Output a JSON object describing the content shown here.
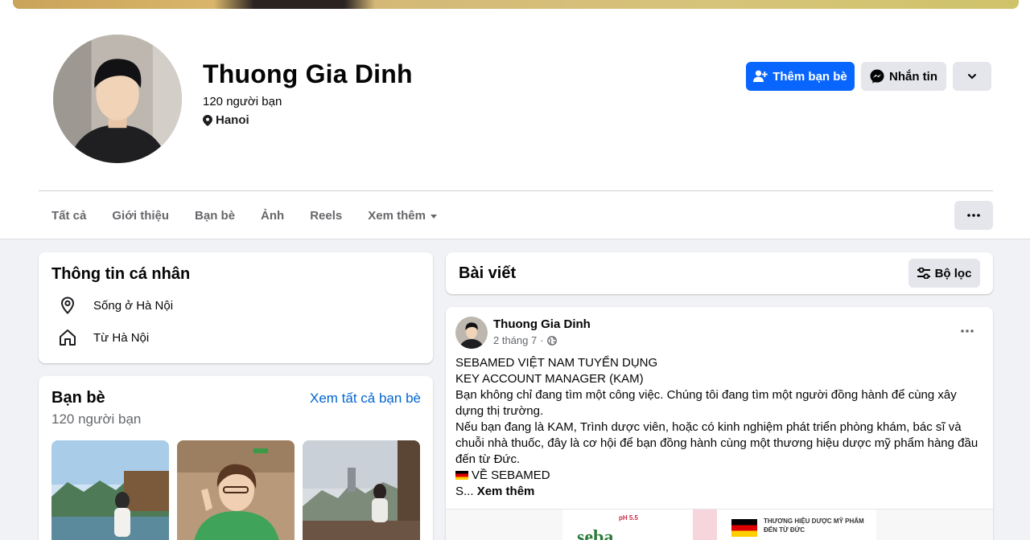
{
  "profile": {
    "name": "Thuong Gia Dinh",
    "friend_count": "120 người bạn",
    "location": "Hanoi"
  },
  "actions": {
    "add_friend": "Thêm bạn bè",
    "message": "Nhắn tin"
  },
  "tabs": [
    {
      "label": "Tất cả"
    },
    {
      "label": "Giới thiệu"
    },
    {
      "label": "Bạn bè"
    },
    {
      "label": "Ảnh"
    },
    {
      "label": "Reels"
    },
    {
      "label": "Xem thêm"
    }
  ],
  "intro": {
    "title": "Thông tin cá nhân",
    "lives_in": "Sống ở Hà Nội",
    "from": "Từ Hà Nội"
  },
  "friends": {
    "title": "Bạn bè",
    "see_all": "Xem tất cả bạn bè",
    "count": "120 người bạn"
  },
  "posts": {
    "title": "Bài viết",
    "filter_label": "Bộ lọc"
  },
  "post": {
    "author": "Thuong Gia Dinh",
    "time": "2 tháng 7",
    "separator": "·",
    "lines": [
      "SEBAMED VIỆT NAM TUYỂN DỤNG",
      "KEY ACCOUNT MANAGER (KAM)",
      "Bạn không chỉ đang tìm một công việc. Chúng tôi đang tìm một người đồng hành để cùng xây",
      "dựng thị trường.",
      "Nếu bạn đang là KAM, Trình dược viên, hoặc có kinh nghiệm phát triển phòng khám, bác sĩ và",
      "chuỗi nhà thuốc, đây là cơ hội để bạn đồng hành cùng một thương hiệu dược mỹ phẩm hàng đầu",
      "đến từ Đức."
    ],
    "about_line": "VỀ SEBAMED",
    "truncated": "S...",
    "see_more": "Xem thêm",
    "image_text": {
      "brand": "seba",
      "ph": "pH 5.5",
      "headline_1": "THƯƠNG HIỆU DƯỢC MỸ PHẨM",
      "headline_2": "ĐẾN TỪ ĐỨC"
    }
  },
  "colors": {
    "primary": "#0866ff",
    "link": "#0064d1",
    "secondary_bg": "#e4e6eb",
    "page_bg": "#f0f2f5"
  }
}
